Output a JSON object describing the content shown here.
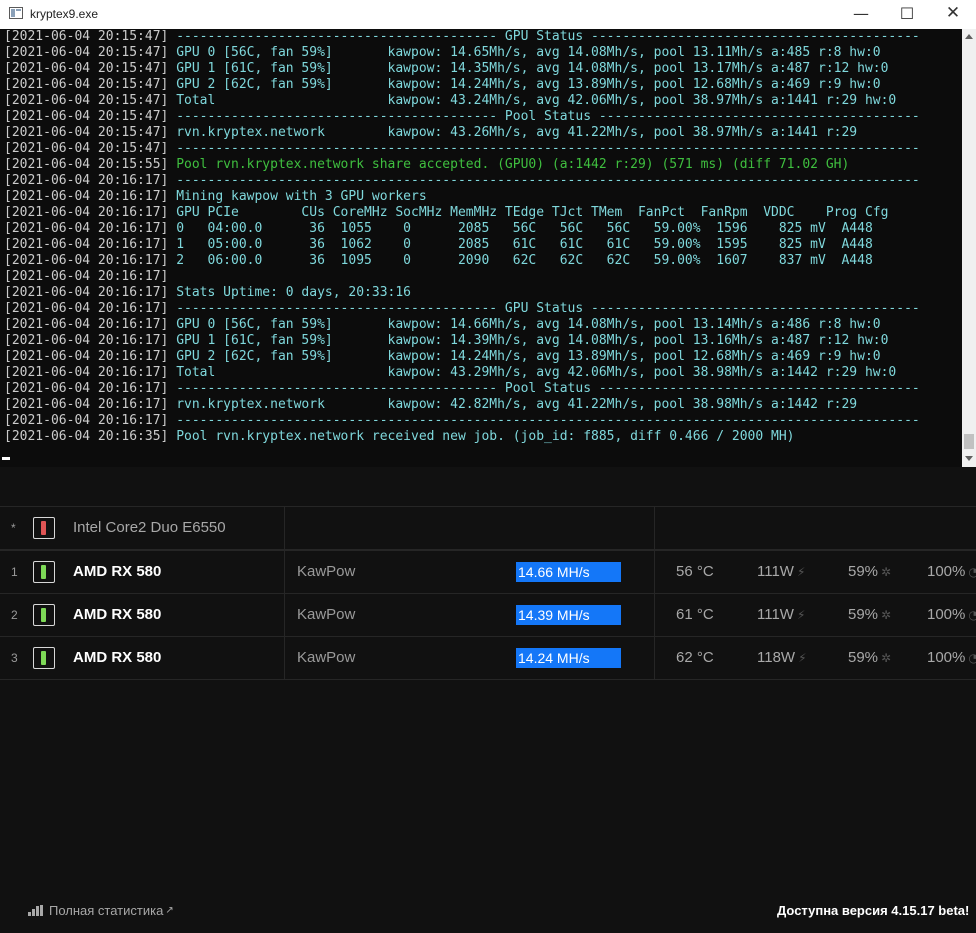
{
  "window": {
    "title": "kryptex9.exe",
    "minimize": "—",
    "maximize": "☐",
    "close": "✕"
  },
  "console": {
    "lines": [
      {
        "ts": "[2021-06-04 20:15:47]",
        "text": " ----------------------------------------- GPU Status ------------------------------------------"
      },
      {
        "ts": "[2021-06-04 20:15:47]",
        "text": " GPU 0 [56C, fan 59%]       kawpow: 14.65Mh/s, avg 14.08Mh/s, pool 13.11Mh/s a:485 r:8 hw:0"
      },
      {
        "ts": "[2021-06-04 20:15:47]",
        "text": " GPU 1 [61C, fan 59%]       kawpow: 14.35Mh/s, avg 14.08Mh/s, pool 13.17Mh/s a:487 r:12 hw:0"
      },
      {
        "ts": "[2021-06-04 20:15:47]",
        "text": " GPU 2 [62C, fan 59%]       kawpow: 14.24Mh/s, avg 13.89Mh/s, pool 12.68Mh/s a:469 r:9 hw:0"
      },
      {
        "ts": "[2021-06-04 20:15:47]",
        "text": " Total                      kawpow: 43.24Mh/s, avg 42.06Mh/s, pool 38.97Mh/s a:1441 r:29 hw:0"
      },
      {
        "ts": "[2021-06-04 20:15:47]",
        "text": " ----------------------------------------- Pool Status -----------------------------------------"
      },
      {
        "ts": "[2021-06-04 20:15:47]",
        "text": " rvn.kryptex.network        kawpow: 43.26Mh/s, avg 41.22Mh/s, pool 38.97Mh/s a:1441 r:29"
      },
      {
        "ts": "[2021-06-04 20:15:47]",
        "text": " -----------------------------------------------------------------------------------------------"
      },
      {
        "ts": "[2021-06-04 20:15:55]",
        "text": " Pool rvn.kryptex.network share accepted. (GPU0) (a:1442 r:29) (571 ms) (diff 71.02 GH)",
        "ok": true
      },
      {
        "ts": "[2021-06-04 20:16:17]",
        "text": " -----------------------------------------------------------------------------------------------"
      },
      {
        "ts": "[2021-06-04 20:16:17]",
        "text": " Mining kawpow with 3 GPU workers"
      },
      {
        "ts": "[2021-06-04 20:16:17]",
        "text": " GPU PCIe        CUs CoreMHz SocMHz MemMHz TEdge TJct TMem  FanPct  FanRpm  VDDC    Prog Cfg"
      },
      {
        "ts": "[2021-06-04 20:16:17]",
        "text": " 0   04:00.0      36  1055    0      2085   56C   56C   56C   59.00%  1596    825 mV  A448"
      },
      {
        "ts": "[2021-06-04 20:16:17]",
        "text": " 1   05:00.0      36  1062    0      2085   61C   61C   61C   59.00%  1595    825 mV  A448"
      },
      {
        "ts": "[2021-06-04 20:16:17]",
        "text": " 2   06:00.0      36  1095    0      2090   62C   62C   62C   59.00%  1607    837 mV  A448"
      },
      {
        "ts": "[2021-06-04 20:16:17]",
        "text": ""
      },
      {
        "ts": "[2021-06-04 20:16:17]",
        "text": " Stats Uptime: 0 days, 20:33:16"
      },
      {
        "ts": "[2021-06-04 20:16:17]",
        "text": " ----------------------------------------- GPU Status ------------------------------------------"
      },
      {
        "ts": "[2021-06-04 20:16:17]",
        "text": " GPU 0 [56C, fan 59%]       kawpow: 14.66Mh/s, avg 14.08Mh/s, pool 13.14Mh/s a:486 r:8 hw:0"
      },
      {
        "ts": "[2021-06-04 20:16:17]",
        "text": " GPU 1 [61C, fan 59%]       kawpow: 14.39Mh/s, avg 14.08Mh/s, pool 13.16Mh/s a:487 r:12 hw:0"
      },
      {
        "ts": "[2021-06-04 20:16:17]",
        "text": " GPU 2 [62C, fan 59%]       kawpow: 14.24Mh/s, avg 13.89Mh/s, pool 12.68Mh/s a:469 r:9 hw:0"
      },
      {
        "ts": "[2021-06-04 20:16:17]",
        "text": " Total                      kawpow: 43.29Mh/s, avg 42.06Mh/s, pool 38.98Mh/s a:1442 r:29 hw:0"
      },
      {
        "ts": "[2021-06-04 20:16:17]",
        "text": " ----------------------------------------- Pool Status -----------------------------------------"
      },
      {
        "ts": "[2021-06-04 20:16:17]",
        "text": " rvn.kryptex.network        kawpow: 42.82Mh/s, avg 41.22Mh/s, pool 38.98Mh/s a:1442 r:29"
      },
      {
        "ts": "[2021-06-04 20:16:17]",
        "text": " -----------------------------------------------------------------------------------------------"
      },
      {
        "ts": "[2021-06-04 20:16:35]",
        "text": " Pool rvn.kryptex.network received new job. (job_id: f885, diff 0.466 / 2000 MH)"
      }
    ]
  },
  "devices": {
    "cpu": {
      "index": "*",
      "name": "Intel Core2 Duo E6550",
      "status_color": "#e05555"
    },
    "gpus": [
      {
        "index": "1",
        "name": "AMD RX 580",
        "algo": "KawPow",
        "hashrate": "14.66 MH/s",
        "temp": "56 °C",
        "power": "111W",
        "fan": "59%",
        "load": "100%",
        "status_color": "#7ed957"
      },
      {
        "index": "2",
        "name": "AMD RX 580",
        "algo": "KawPow",
        "hashrate": "14.39 MH/s",
        "temp": "61 °C",
        "power": "111W",
        "fan": "59%",
        "load": "100%",
        "status_color": "#7ed957"
      },
      {
        "index": "3",
        "name": "AMD RX 580",
        "algo": "KawPow",
        "hashrate": "14.24 MH/s",
        "temp": "62 °C",
        "power": "118W",
        "fan": "59%",
        "load": "100%",
        "status_color": "#7ed957"
      }
    ]
  },
  "icons": {
    "power": "bolt-icon",
    "fan": "fan-icon",
    "load": "gauge-icon",
    "stats": "bar-chart-icon",
    "external": "external-link-icon"
  },
  "colors": {
    "hashrate_bar": "#1477f8",
    "console_text": "#7fd8dc",
    "accepted_text": "#3fbf3f"
  },
  "footer": {
    "stats_link": "Полная статистика",
    "version_notice": "Доступна версия 4.15.17 beta!"
  }
}
